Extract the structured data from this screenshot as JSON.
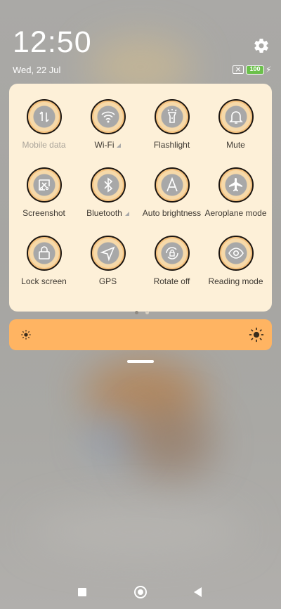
{
  "status": {
    "time": "12:50",
    "date": "Wed, 22 Jul",
    "battery": "100"
  },
  "quick_settings": [
    {
      "name": "mobile-data",
      "label": "Mobile data",
      "icon": "mobile-data-icon",
      "enabled": false
    },
    {
      "name": "wifi",
      "label": "Wi-Fi",
      "icon": "wifi-icon",
      "enabled": true,
      "has_expand": true
    },
    {
      "name": "flashlight",
      "label": "Flashlight",
      "icon": "flashlight-icon",
      "enabled": true
    },
    {
      "name": "mute",
      "label": "Mute",
      "icon": "bell-icon",
      "enabled": true
    },
    {
      "name": "screenshot",
      "label": "Screenshot",
      "icon": "screenshot-icon",
      "enabled": true
    },
    {
      "name": "bluetooth",
      "label": "Bluetooth",
      "icon": "bluetooth-icon",
      "enabled": true,
      "has_expand": true
    },
    {
      "name": "auto-brightness",
      "label": "Auto brightness",
      "icon": "auto-brightness-icon",
      "enabled": true
    },
    {
      "name": "aeroplane-mode",
      "label": "Aeroplane mode",
      "icon": "aeroplane-icon",
      "enabled": true
    },
    {
      "name": "lock-screen",
      "label": "Lock screen",
      "icon": "lock-icon",
      "enabled": true
    },
    {
      "name": "gps",
      "label": "GPS",
      "icon": "location-arrow-icon",
      "enabled": true
    },
    {
      "name": "rotate-off",
      "label": "Rotate off",
      "icon": "rotate-lock-icon",
      "enabled": true
    },
    {
      "name": "reading-mode",
      "label": "Reading mode",
      "icon": "eye-icon",
      "enabled": true
    }
  ],
  "pager": {
    "pages": 2,
    "current": 1
  },
  "brightness": {
    "level": 1.0,
    "color": "#ffb462"
  },
  "colors": {
    "panel_bg": "#fdf0d8",
    "accent": "#ffb462",
    "battery_green": "#6bc04b"
  }
}
